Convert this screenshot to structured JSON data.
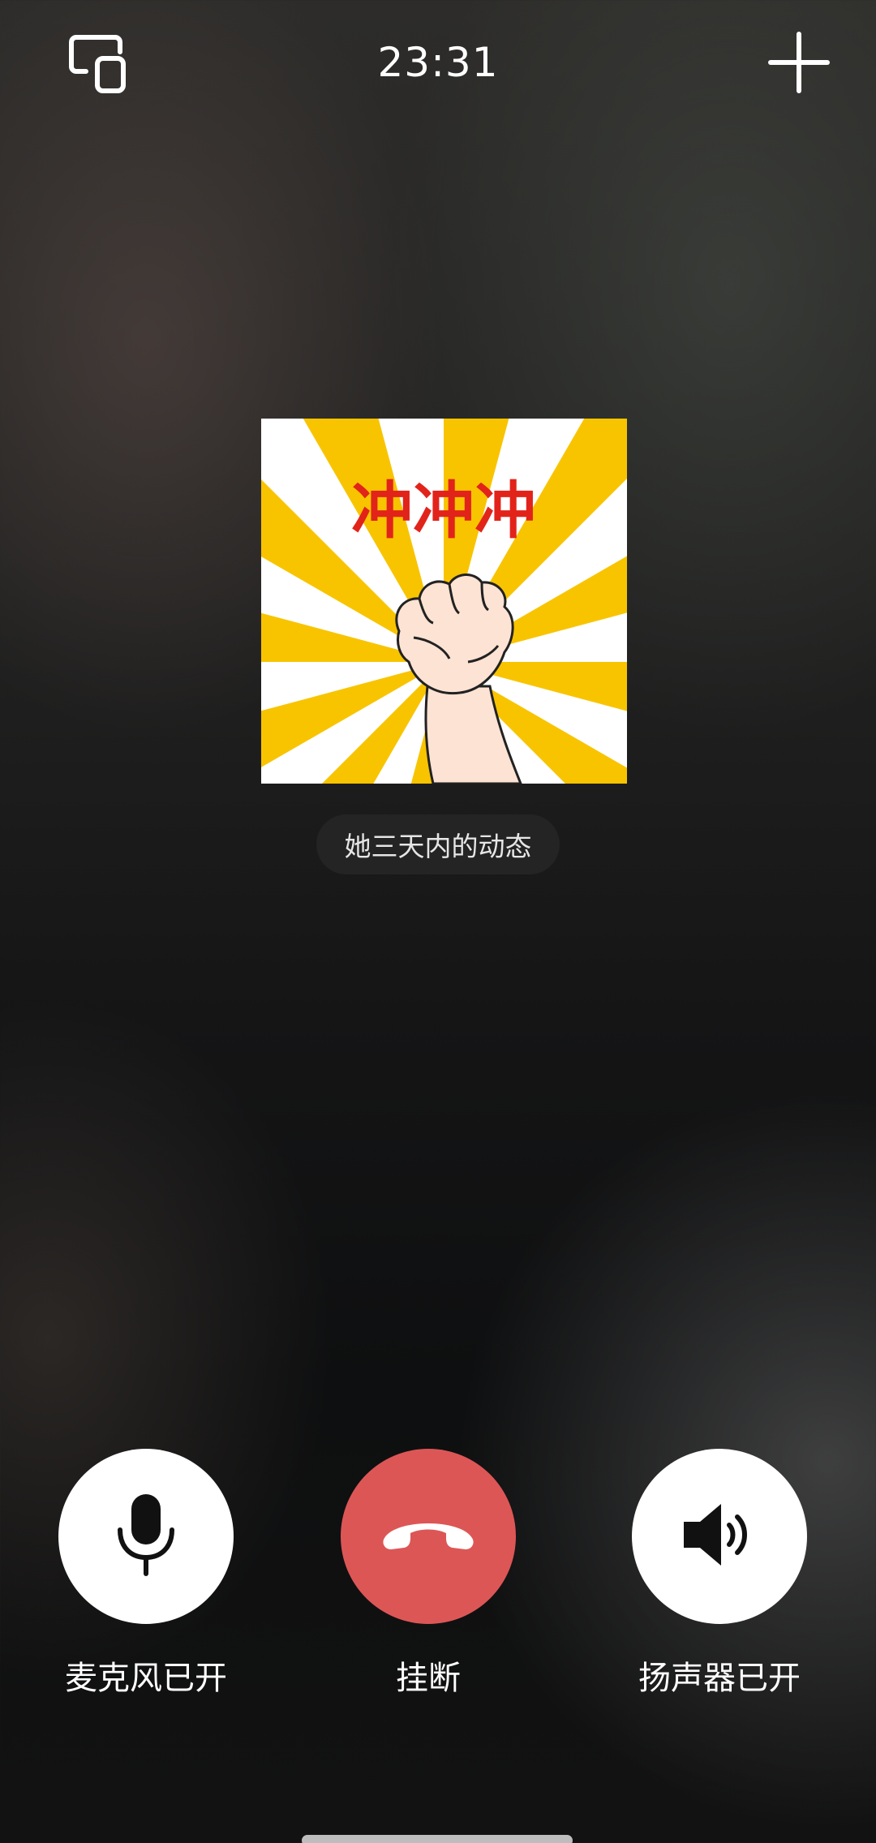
{
  "status": {
    "time": "23:31"
  },
  "icons": {
    "minimize": "minimize-window-icon",
    "add": "plus-icon",
    "mic": "microphone-icon",
    "hangup": "phone-hangup-icon",
    "speaker": "speaker-icon"
  },
  "sticker": {
    "text": "冲冲冲",
    "colors": {
      "rays": "#f8c400",
      "text": "#e2231a"
    }
  },
  "moments_label": "她三天内的动态",
  "controls": {
    "mic_label": "麦克风已开",
    "hangup_label": "挂断",
    "speaker_label": "扬声器已开"
  },
  "colors": {
    "hangup": "#dd5656",
    "control_bg": "#ffffff"
  }
}
